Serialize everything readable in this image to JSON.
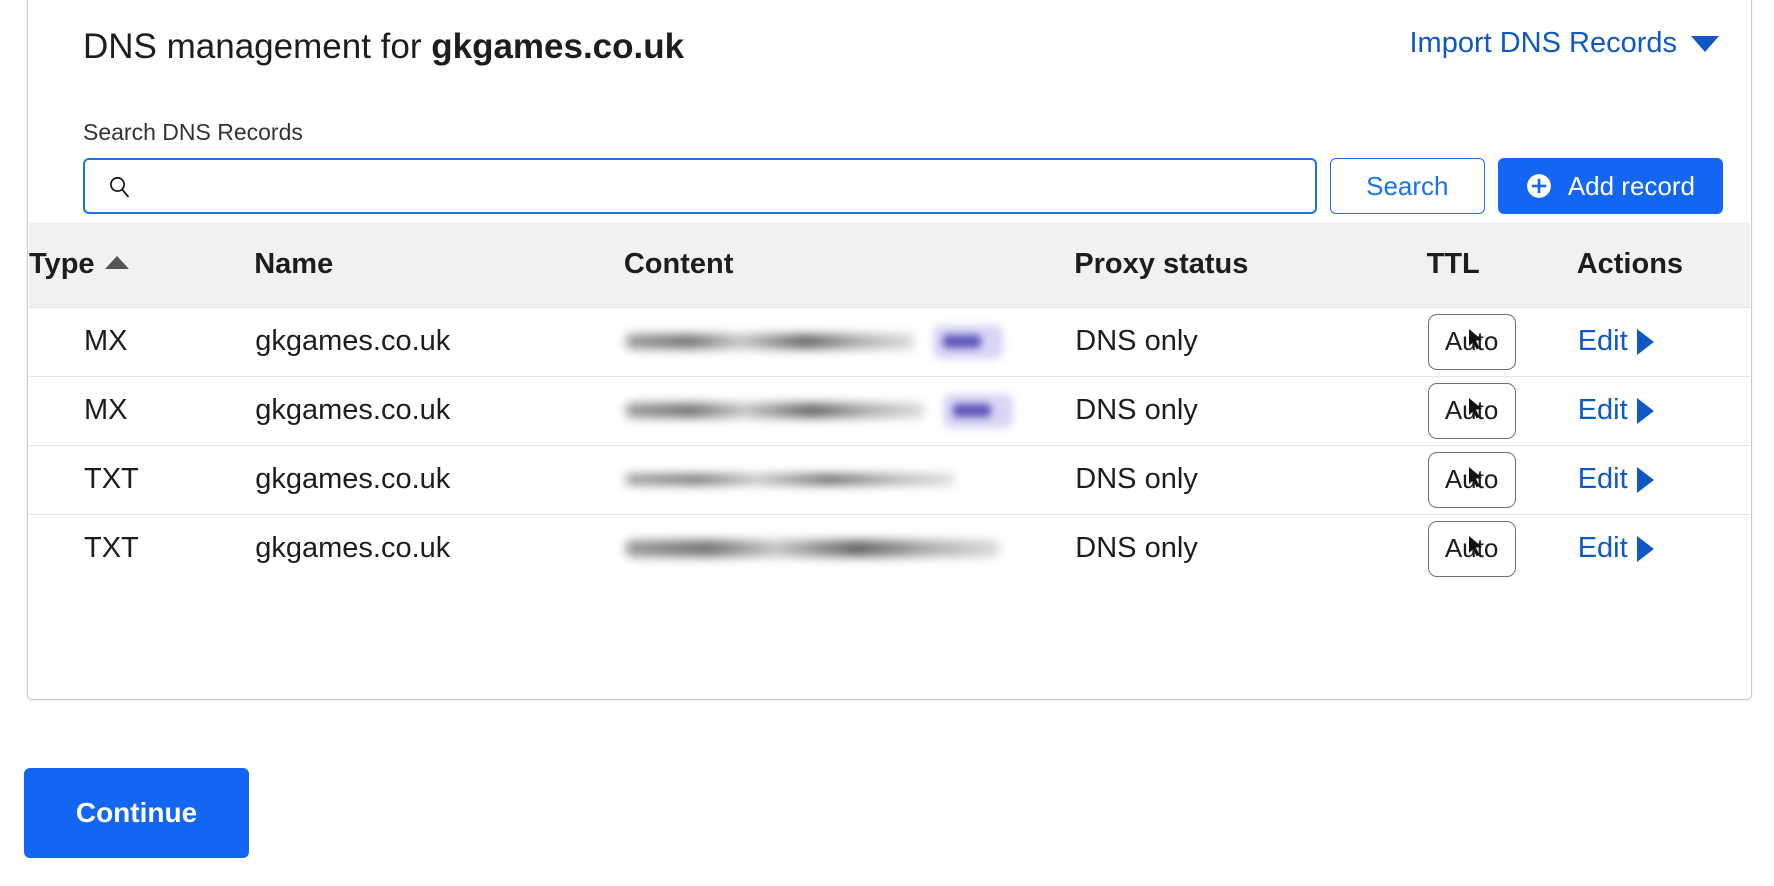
{
  "card": {
    "title_prefix": "DNS management for ",
    "title_domain": "gkgames.co.uk",
    "import_link": "Import DNS Records",
    "import_caret_icon": "chevron-down-icon"
  },
  "search": {
    "label": "Search DNS Records",
    "value": "",
    "placeholder": "",
    "icon": "search-icon",
    "search_button": "Search",
    "add_button": "Add record",
    "add_button_icon": "plus-circle-icon"
  },
  "table": {
    "columns": [
      {
        "key": "type",
        "label": "Type",
        "sort": "asc",
        "sort_icon": "sort-ascending-icon"
      },
      {
        "key": "name",
        "label": "Name"
      },
      {
        "key": "content",
        "label": "Content"
      },
      {
        "key": "proxy",
        "label": "Proxy status"
      },
      {
        "key": "ttl",
        "label": "TTL"
      },
      {
        "key": "actions",
        "label": "Actions"
      }
    ],
    "rows": [
      {
        "type": "MX",
        "name": "gkgames.co.uk",
        "content": "",
        "content_redacted": true,
        "has_priority_badge": true,
        "proxy": "DNS only",
        "ttl": "Auto",
        "action": "Edit",
        "action_icon": "chevron-right-icon"
      },
      {
        "type": "MX",
        "name": "gkgames.co.uk",
        "content": "",
        "content_redacted": true,
        "has_priority_badge": true,
        "proxy": "DNS only",
        "ttl": "Auto",
        "action": "Edit",
        "action_icon": "chevron-right-icon"
      },
      {
        "type": "TXT",
        "name": "gkgames.co.uk",
        "content": "",
        "content_redacted": true,
        "has_priority_badge": false,
        "proxy": "DNS only",
        "ttl": "Auto",
        "action": "Edit",
        "action_icon": "chevron-right-icon"
      },
      {
        "type": "TXT",
        "name": "gkgames.co.uk",
        "content": "",
        "content_redacted": true,
        "has_priority_badge": false,
        "proxy": "DNS only",
        "ttl": "Auto",
        "action": "Edit",
        "action_icon": "chevron-right-icon"
      }
    ]
  },
  "footer": {
    "continue_label": "Continue"
  },
  "colors": {
    "primary_blue": "#1266f1",
    "link_blue": "#1059c4",
    "input_border_blue": "#1a73e8",
    "header_bg": "#f1f1f1",
    "badge_purple": "#5b53b8"
  }
}
